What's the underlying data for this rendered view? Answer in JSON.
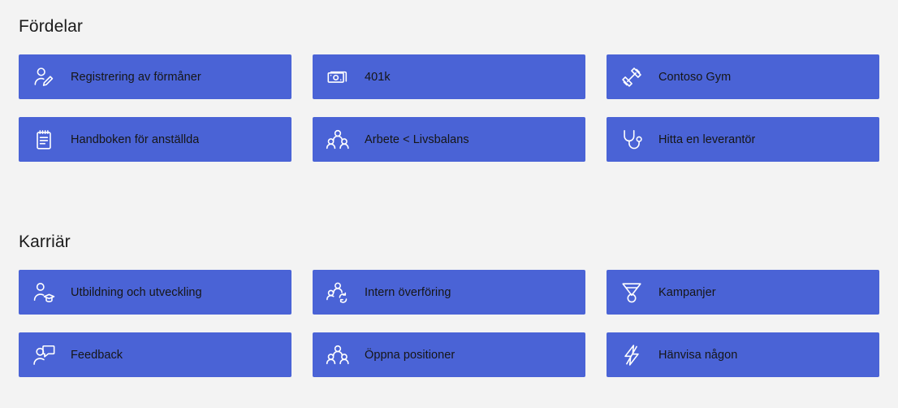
{
  "theme": {
    "background": "#f3f3f3",
    "tile_color": "#4a63d6",
    "tile_icon_color": "#ffffff",
    "tile_label_color": "#161616",
    "heading_color": "#1b1b1b"
  },
  "sections": [
    {
      "id": "benefits",
      "heading": "Fördelar",
      "tiles": [
        {
          "label": "Registrering av förmåner",
          "icon": "person-edit-icon"
        },
        {
          "label": "401k",
          "icon": "banknote-icon"
        },
        {
          "label": "Contoso Gym",
          "icon": "dumbbell-icon"
        },
        {
          "label": "Handboken för anställda",
          "icon": "notepad-icon"
        },
        {
          "label": "Arbete <  Livsbalans",
          "icon": "people-group-icon"
        },
        {
          "label": "Hitta en leverantör",
          "icon": "stethoscope-icon"
        }
      ]
    },
    {
      "id": "career",
      "heading": "Karriär",
      "tiles": [
        {
          "label": "Utbildning och utveckling",
          "icon": "person-graduation-icon"
        },
        {
          "label": "Intern överföring",
          "icon": "people-sync-icon"
        },
        {
          "label": "Kampanjer",
          "icon": "medal-icon"
        },
        {
          "label": "Feedback",
          "icon": "person-feedback-icon"
        },
        {
          "label": "Öppna positioner",
          "icon": "people-group-icon"
        },
        {
          "label": "Hänvisa någon",
          "icon": "lightning-bolt-icon"
        }
      ]
    }
  ]
}
